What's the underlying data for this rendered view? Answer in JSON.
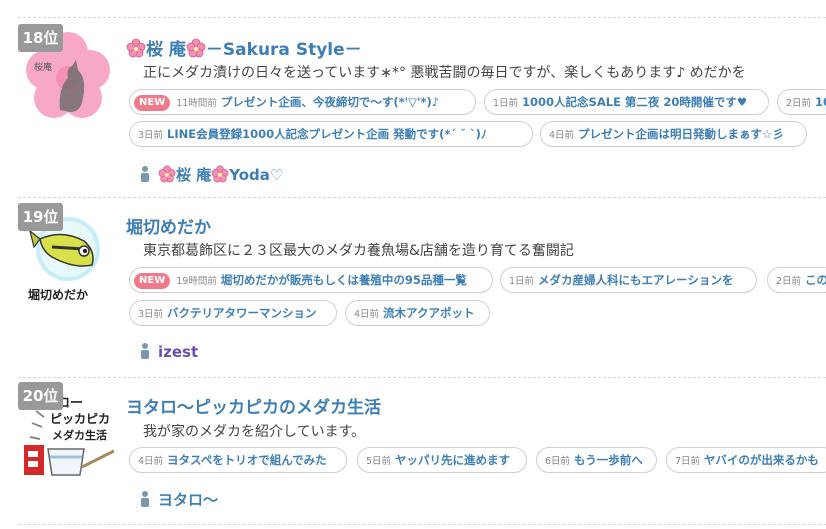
{
  "entries": [
    {
      "rank": "18位",
      "title_mid": "桜 庵",
      "title_end": "－Sakura Style－",
      "description": "正にメダカ漬けの日々を送っています∗*° 悪戦苦闘の毎日ですが、楽しくもあります♪ めだかを",
      "new_badge": "NEW",
      "thumb_text": "桜庵",
      "posts_row1": [
        {
          "when": "11時間前",
          "text": "プレゼント企画、今夜締切で～す(*'▽'*)♪"
        },
        {
          "when": "1日前",
          "text": "1000人記念SALE 第二夜 20時開催です♥"
        },
        {
          "when": "2日前",
          "text": "10"
        }
      ],
      "posts_row2": [
        {
          "when": "3日前",
          "text": "LINE会員登録1000人記念プレゼント企画 発動です(*´ ˘ `)ﾉ"
        },
        {
          "when": "4日前",
          "text": "プレゼント企画は明日発動しまぁす☆彡"
        }
      ],
      "author": "桜 庵",
      "author_suffix": "Yoda♡"
    },
    {
      "rank": "19位",
      "title": "堀切めだか",
      "description": "東京都葛飾区に２３区最大のメダカ養魚場&店舗を造り育てる奮闘記",
      "new_badge": "NEW",
      "thumb_text": "堀切めだか",
      "posts_row1": [
        {
          "when": "19時間前",
          "text": "堀切めだかが販売もしくは養殖中の95品種一覧"
        },
        {
          "when": "1日前",
          "text": "メダカ産婦人科にもエアレーションを"
        },
        {
          "when": "2日前",
          "text": "この"
        }
      ],
      "posts_row2": [
        {
          "when": "3日前",
          "text": "バクテリアタワーマンション"
        },
        {
          "when": "4日前",
          "text": "流木アクアポット"
        }
      ],
      "author": "izest"
    },
    {
      "rank": "20位",
      "title": "ヨタロ～ピッカピカのメダカ生活",
      "description": "我が家のメダカを紹介しています。",
      "thumb_lines": [
        "タロー",
        "ピッカピカ",
        "メダカ生活"
      ],
      "posts_row1": [
        {
          "when": "4日前",
          "text": "ヨタスペをトリオで組んでみた"
        },
        {
          "when": "5日前",
          "text": "ヤッパリ先に進めます"
        },
        {
          "when": "6日前",
          "text": "もう一歩前へ"
        },
        {
          "when": "7日前",
          "text": "ヤバイのが出来るかも"
        }
      ],
      "author": "ヨタロ～"
    }
  ],
  "colors": {
    "title": "#3d7fb5",
    "rank_bg": "#999999",
    "new_badge": "#f07a8a",
    "author_izest": "#6b4fb0"
  },
  "icons": [
    "sakura-icon",
    "person-icon"
  ]
}
